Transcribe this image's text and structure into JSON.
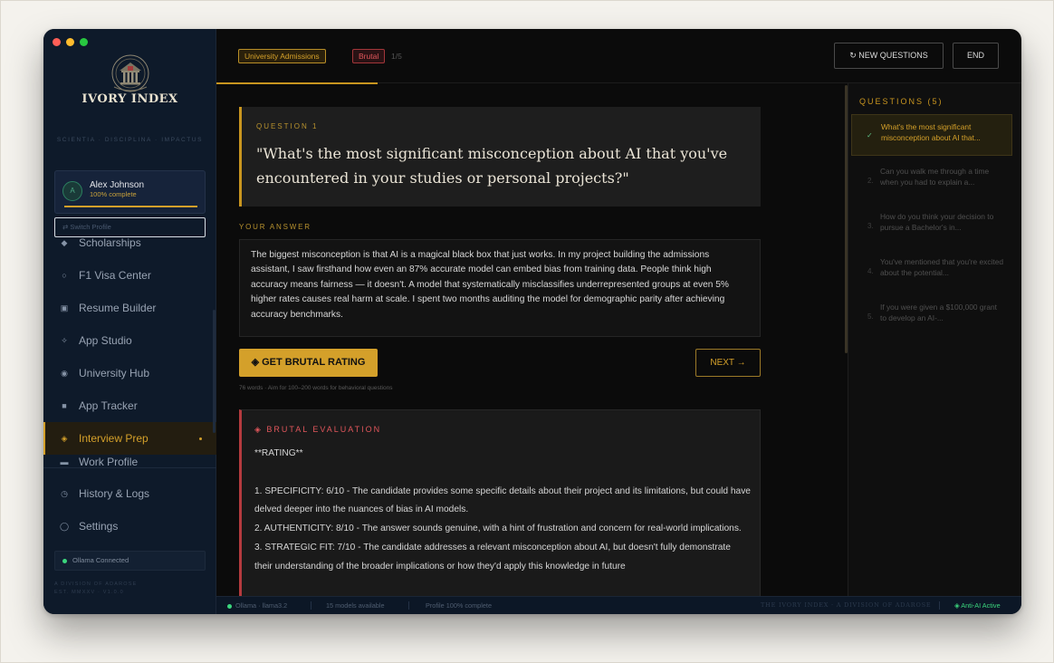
{
  "window": {
    "traffic_colors": [
      "#ff5f57",
      "#febc2e",
      "#28c840"
    ]
  },
  "sidebar": {
    "logo_title": "IVORY INDEX",
    "motto": "SCIENTIA · DISCIPLINA · IMPACTUS",
    "profile": {
      "avatar_initial": "A",
      "name": "Alex Johnson",
      "completion_text": "100% complete",
      "completion": 1.0
    },
    "switch_profile": "⇄  Switch Profile",
    "nav_items": [
      {
        "label": "Scholarships",
        "icon": "diamond-icon",
        "glyph": "◆"
      },
      {
        "label": "F1 Visa Center",
        "icon": "circle-icon",
        "glyph": "○"
      },
      {
        "label": "Resume Builder",
        "icon": "document-icon",
        "glyph": "▣"
      },
      {
        "label": "App Studio",
        "icon": "sparkle-icon",
        "glyph": "✧"
      },
      {
        "label": "University Hub",
        "icon": "target-icon",
        "glyph": "◉"
      },
      {
        "label": "App Tracker",
        "icon": "square-icon",
        "glyph": "■"
      },
      {
        "label": "Interview Prep",
        "icon": "diamond-outline-icon",
        "glyph": "◈",
        "active": true
      },
      {
        "label": "Work Profile",
        "icon": "briefcase-icon",
        "glyph": "▬"
      }
    ],
    "bottom_items": [
      {
        "label": "History & Logs",
        "icon": "history-icon",
        "glyph": "◷"
      },
      {
        "label": "Settings",
        "icon": "gear-icon",
        "glyph": "◯"
      }
    ],
    "ollama_status": "Ollama Connected",
    "division_line1": "A DIVISION OF ADAROSE",
    "division_line2": "EST. MMXXV · V1.0.0"
  },
  "topbar": {
    "tag_category": "University Admissions",
    "tag_mode": "Brutal",
    "counter": "1/5",
    "new_questions": "↻ NEW QUESTIONS",
    "end": "END"
  },
  "question": {
    "label": "QUESTION 1",
    "text": "\"What's the most significant misconception about AI that you've encountered in your studies or personal projects?\""
  },
  "answer": {
    "label": "YOUR ANSWER",
    "text": "The biggest misconception is that AI is a magical black box that just works. In my project building the admissions assistant, I saw firsthand how even an 87% accurate model can embed bias from training data. People think high accuracy means fairness — it doesn't. A model that systematically misclassifies underrepresented groups at even 5% higher rates causes real harm at scale. I spent two months auditing the model for demographic parity after achieving accuracy benchmarks."
  },
  "actions": {
    "get_rating": "◈ GET BRUTAL RATING",
    "next": "NEXT →",
    "word_count": "76 words · Aim for 100–200 words for behavioral questions"
  },
  "evaluation": {
    "label": "◈ BRUTAL EVALUATION",
    "text": "**RATING**\n\n1. SPECIFICITY: 6/10 - The candidate provides some specific details about their project and its limitations, but could have delved deeper into the nuances of bias in AI models.\n2. AUTHENTICITY: 8/10 - The answer sounds genuine, with a hint of frustration and concern for real-world implications.\n3. STRATEGIC FIT: 7/10 - The candidate addresses a relevant misconception about AI, but doesn't fully demonstrate their understanding of the broader implications or how they'd apply this knowledge in future"
  },
  "questions_panel": {
    "header": "QUESTIONS (5)",
    "items": [
      {
        "num": "✓",
        "text": "What's the most significant misconception about AI that...",
        "active": true
      },
      {
        "num": "2.",
        "text": "Can you walk me through a time when you had to explain a..."
      },
      {
        "num": "3.",
        "text": "How do you think your decision to pursue a Bachelor's in..."
      },
      {
        "num": "4.",
        "text": "You've mentioned that you're excited about the potential..."
      },
      {
        "num": "5.",
        "text": "If you were given a $100,000 grant to develop an AI-..."
      }
    ]
  },
  "statusbar": {
    "model": "Ollama · llama3.2",
    "models_available": "15 models available",
    "profile": "Profile 100% complete",
    "brand": "THE IVORY INDEX · A DIVISION OF ADAROSE",
    "anti_ai": "◈ Anti-AI Active"
  },
  "colors": {
    "accent": "#d4a02a",
    "danger": "#e0565b",
    "success": "#3bd67d",
    "sidebar_bg": "#0e1a2a"
  }
}
